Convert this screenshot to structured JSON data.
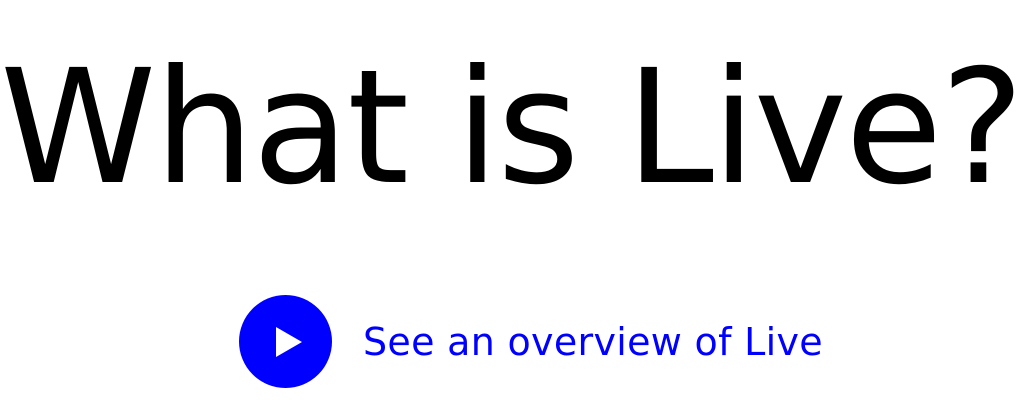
{
  "hero": {
    "title": "What is Live?",
    "video_link": {
      "label": "See an overview of Live",
      "icon": "play-icon"
    }
  },
  "colors": {
    "background": "#ffffff",
    "title": "#000000",
    "accent": "#0000ff",
    "icon_fill": "#ffffff"
  }
}
